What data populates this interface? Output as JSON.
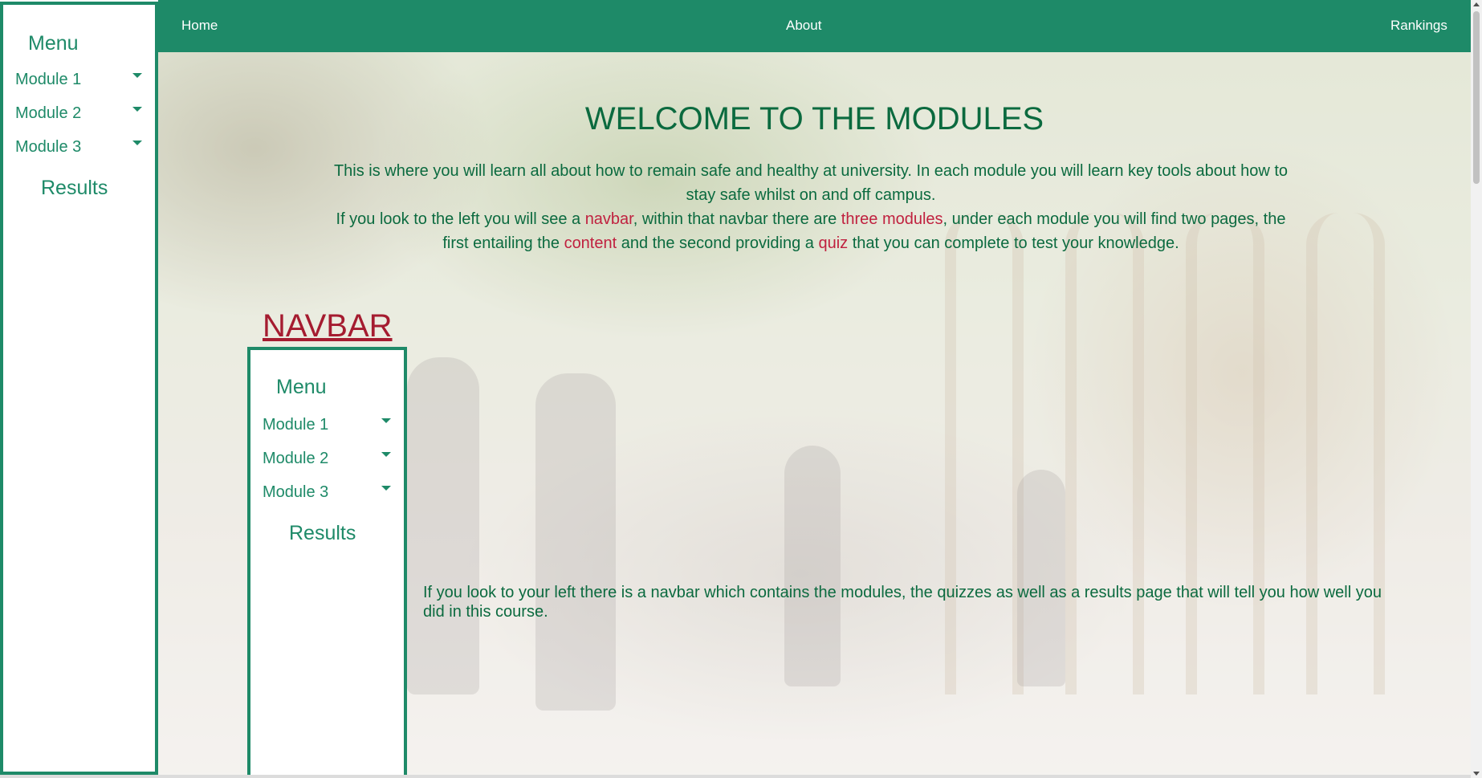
{
  "topnav": {
    "home": "Home",
    "about": "About",
    "rankings": "Rankings"
  },
  "sidebar": {
    "menu_title": "Menu",
    "items": [
      {
        "label": "Module 1"
      },
      {
        "label": "Module 2"
      },
      {
        "label": "Module 3"
      }
    ],
    "results": "Results"
  },
  "main": {
    "title": "WELCOME TO THE MODULES",
    "intro_1": "This is where you will learn all about how to remain safe and healthy at university. In each module you will learn key tools about how to stay safe whilst on and off campus.",
    "intro_2a": "If you look to the left you will see a ",
    "intro_2_navbar": "navbar",
    "intro_2b": ", within that navbar there are ",
    "intro_2_three": "three modules",
    "intro_2c": ", under each module you will find two pages, the first entailing the ",
    "intro_2_content": "content",
    "intro_2d": " and the second providing a ",
    "intro_2_quiz": "quiz",
    "intro_2e": " that you can complete to test your knowledge.",
    "navbar_heading": "NAVBAR",
    "navbar_paragraph": "If you look to your left there is a navbar which contains the modules, the quizzes as well as a results page that will tell you how well you did in this course."
  },
  "example_menu": {
    "menu_title": "Menu",
    "items": [
      {
        "label": "Module 1"
      },
      {
        "label": "Module 2"
      },
      {
        "label": "Module 3"
      }
    ],
    "results": "Results"
  },
  "colors": {
    "accent": "#1e8a68",
    "text_green": "#0b6a3f",
    "highlight": "#c0213f"
  }
}
